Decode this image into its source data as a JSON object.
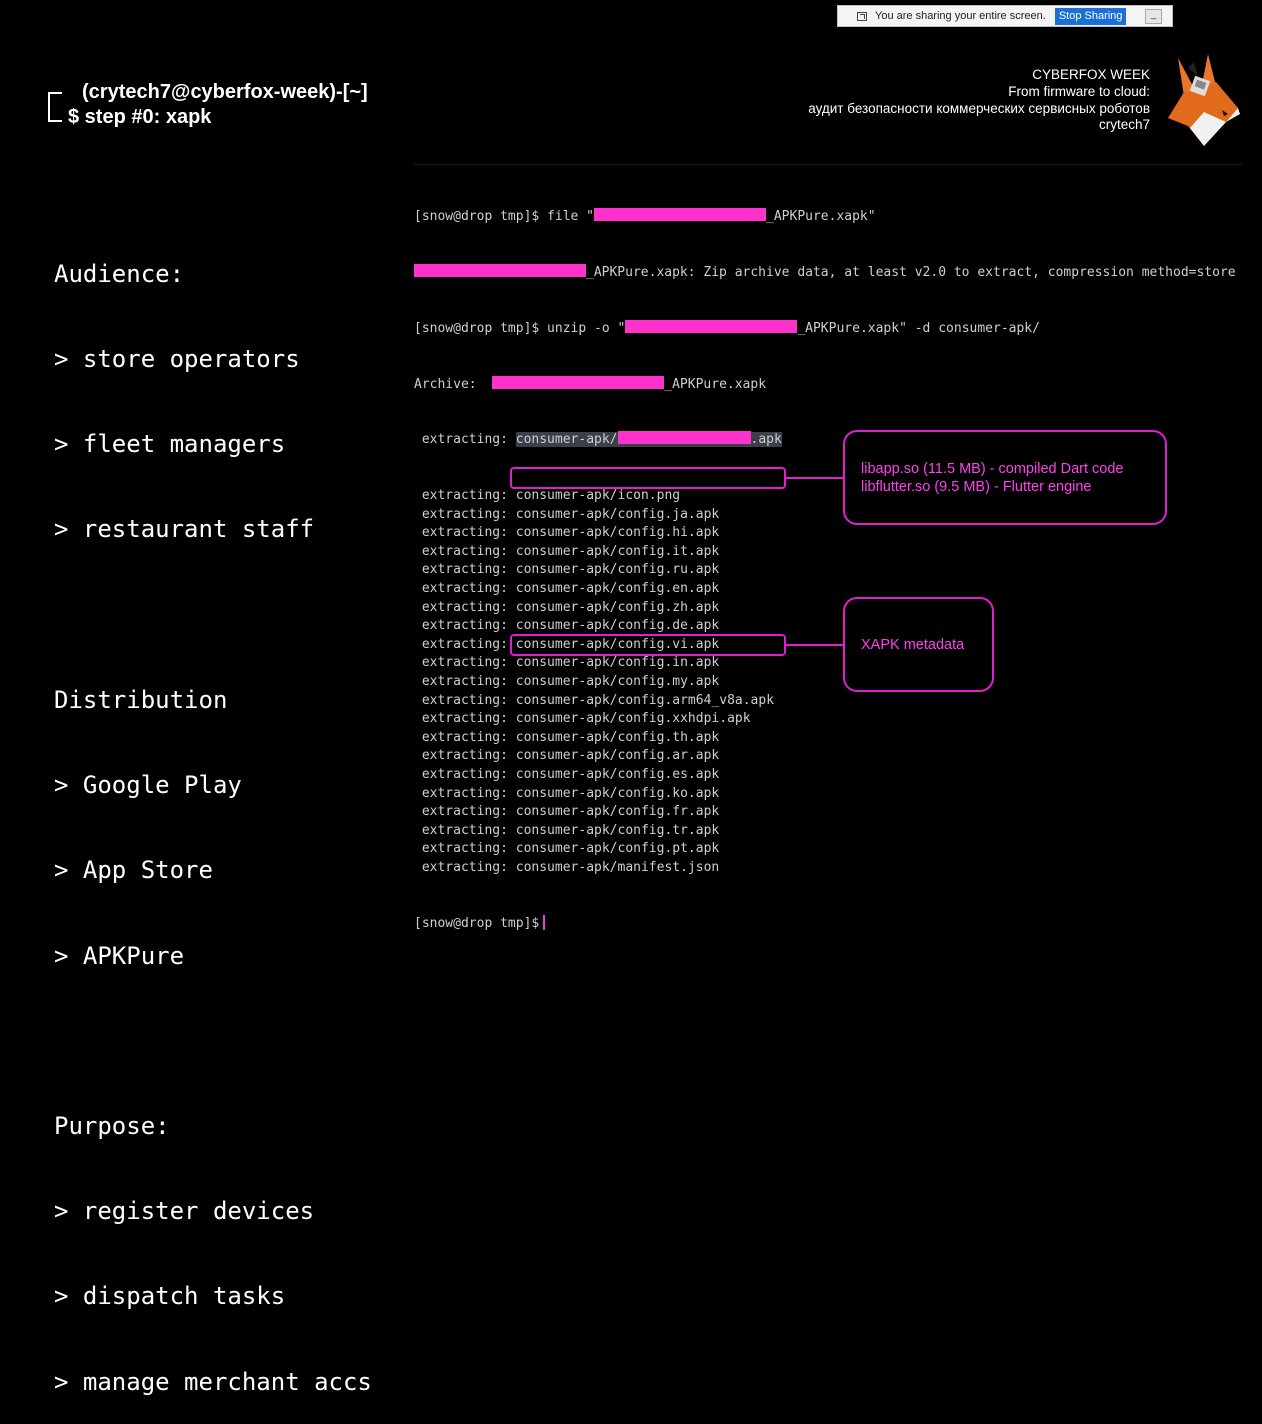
{
  "share_bar": {
    "text": "You are sharing your entire screen.",
    "stop_label": "Stop Sharing",
    "minimize_label": "_"
  },
  "prompt": {
    "line1": "(crytech7@cyberfox-week)-[~]",
    "line2": "$ step #0: xapk"
  },
  "brand": {
    "line1": "CYBERFOX WEEK",
    "line2": "From firmware to cloud:",
    "line3": "аудит безопасности коммерческих сервисных роботов",
    "line4": "crytech7",
    "logo_icon": "fox-logo-icon"
  },
  "left_panel": {
    "audience_title": "Audience:",
    "audience_items": [
      "> store operators",
      "> fleet managers",
      "> restaurant staff"
    ],
    "distribution_title": "Distribution",
    "distribution_items": [
      "> Google Play",
      "> App Store",
      "> APKPure"
    ],
    "purpose_title": "Purpose:",
    "purpose_items": [
      "> register devices",
      "> dispatch tasks",
      "> manage merchant accs"
    ]
  },
  "terminal": {
    "cmd1_prefix": "[snow@drop tmp]$ file \"",
    "cmd1_suffix": "_APKPure.xapk\"",
    "out1_suffix": "_APKPure.xapk: Zip archive data, at least v2.0 to extract, compression method=store",
    "cmd2_prefix": "[snow@drop tmp]$ unzip -o \"",
    "cmd2_suffix": "_APKPure.xapk\" -d consumer-apk/",
    "archive_prefix": "Archive:  ",
    "archive_suffix": "_APKPure.xapk",
    "extract_label": " extracting: ",
    "first_extract_prefix": "consumer-apk/",
    "first_extract_suffix": ".apk",
    "extracted_files": [
      "consumer-apk/icon.png",
      "consumer-apk/config.ja.apk",
      "consumer-apk/config.hi.apk",
      "consumer-apk/config.it.apk",
      "consumer-apk/config.ru.apk",
      "consumer-apk/config.en.apk",
      "consumer-apk/config.zh.apk",
      "consumer-apk/config.de.apk",
      "consumer-apk/config.vi.apk",
      "consumer-apk/config.in.apk",
      "consumer-apk/config.my.apk",
      "consumer-apk/config.arm64_v8a.apk",
      "consumer-apk/config.xxhdpi.apk",
      "consumer-apk/config.th.apk",
      "consumer-apk/config.ar.apk",
      "consumer-apk/config.es.apk",
      "consumer-apk/config.ko.apk",
      "consumer-apk/config.fr.apk",
      "consumer-apk/config.tr.apk",
      "consumer-apk/config.pt.apk",
      "consumer-apk/manifest.json"
    ],
    "final_prompt": "[snow@drop tmp]$"
  },
  "callouts": {
    "arm64_line1": "libapp.so (11.5 MB) - compiled Dart code",
    "arm64_line2": "libflutter.so (9.5 MB) - Flutter engine",
    "manifest": "XAPK metadata"
  },
  "colors": {
    "accent": "#e020d0",
    "redaction": "#ff33cc",
    "stop_button": "#1a6fd8"
  }
}
